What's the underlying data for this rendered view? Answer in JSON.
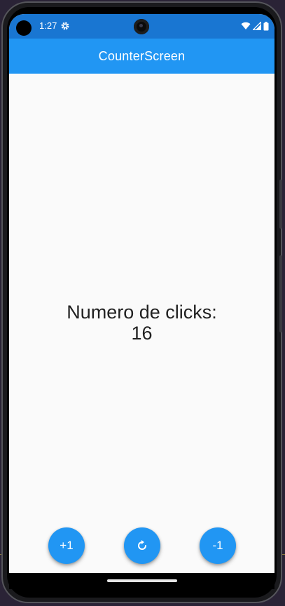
{
  "status_bar": {
    "time": "1:27",
    "icons": [
      "settings-gear-icon",
      "wifi-icon",
      "cellular-signal-icon",
      "battery-icon"
    ]
  },
  "app_bar": {
    "title": "CounterScreen"
  },
  "counter": {
    "label": "Numero de clicks:",
    "value": "16"
  },
  "actions": {
    "increment_label": "+1",
    "reset_icon": "refresh-icon",
    "decrement_label": "-1"
  },
  "colors": {
    "status_bar": "#1976d2",
    "app_bar": "#2196f3",
    "fab": "#2196f3",
    "background": "#fafafa",
    "text": "#212121"
  }
}
